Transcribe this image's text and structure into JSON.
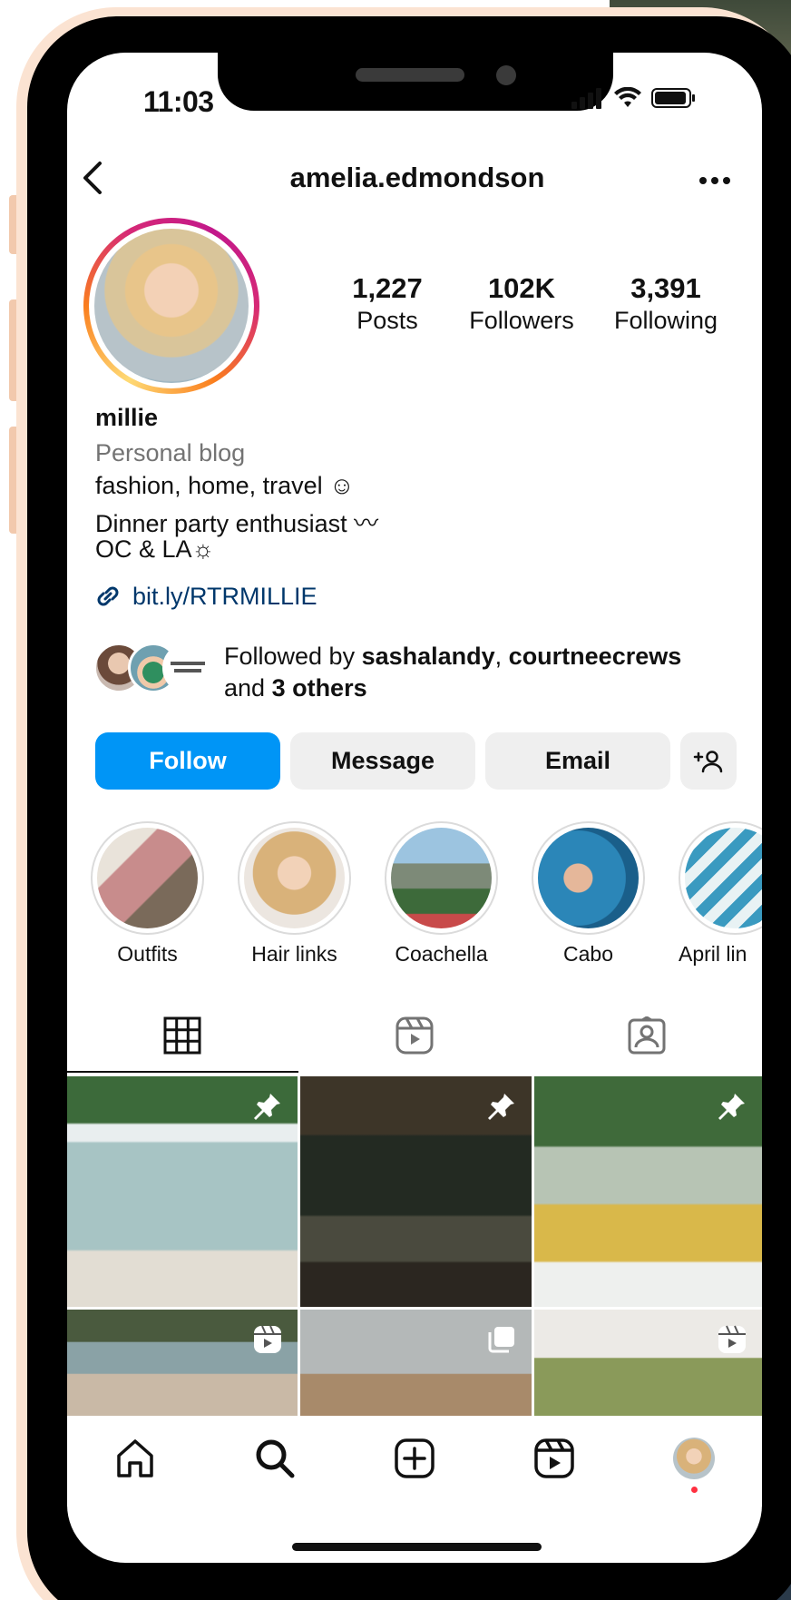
{
  "status_bar": {
    "time": "11:03"
  },
  "header": {
    "username": "amelia.edmondson"
  },
  "profile": {
    "stats": [
      {
        "value": "1,227",
        "label": "Posts"
      },
      {
        "value": "102K",
        "label": "Followers"
      },
      {
        "value": "3,391",
        "label": "Following"
      }
    ],
    "name": "millie",
    "category": "Personal blog",
    "bio_lines": [
      "fashion, home, travel ☺",
      "Dinner party enthusiast 〰",
      "OC & LA☼"
    ],
    "link": "bit.ly/RTRMILLIE",
    "mutual": {
      "prefix": "Followed by ",
      "user1": "sashalandy",
      "separator": ", ",
      "user2": "courtneecrews",
      "and": "and ",
      "others": "3 others"
    }
  },
  "actions": {
    "follow": "Follow",
    "message": "Message",
    "email": "Email"
  },
  "highlights": [
    {
      "label": "Outfits"
    },
    {
      "label": "Hair links"
    },
    {
      "label": "Coachella"
    },
    {
      "label": "Cabo"
    },
    {
      "label": "April lin"
    }
  ],
  "colors": {
    "follow_button": "#0095f6",
    "secondary_button": "#efefef",
    "link": "#00376b",
    "muted_text": "#737373",
    "notification_dot": "#ff3040"
  },
  "icons": {
    "tabs": [
      "grid-icon",
      "reels-tab-icon",
      "tagged-icon"
    ],
    "nav": [
      "home-icon",
      "search-icon",
      "create-icon",
      "reels-icon",
      "profile-avatar-icon"
    ]
  }
}
